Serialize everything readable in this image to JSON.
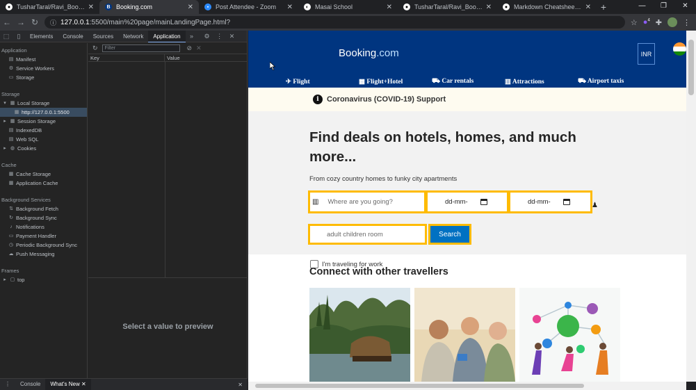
{
  "browser": {
    "tabs": [
      {
        "title": "TusharTaral/Ravi_Booking.com",
        "icon": "github-icon"
      },
      {
        "title": "Booking.com",
        "icon": "booking-icon",
        "active": true
      },
      {
        "title": "Post Attendee - Zoom",
        "icon": "zoom-icon"
      },
      {
        "title": "Masai School",
        "icon": "masai-icon"
      },
      {
        "title": "TusharTaral/Ravi_Booking.com",
        "icon": "github-icon"
      },
      {
        "title": "Markdown Cheatsheet - adam-p",
        "icon": "github-icon"
      }
    ],
    "new_tab": "+",
    "url_host": "127.0.0.1",
    "url_rest": ":5500/main%20page/mainLandingPage.html?",
    "extension_badge": "4",
    "window_controls": [
      "—",
      "❐",
      "✕"
    ]
  },
  "devtools": {
    "tabs": [
      "Elements",
      "Console",
      "Sources",
      "Network",
      "Application"
    ],
    "active_tab": "Application",
    "more": "»",
    "sidebar": {
      "application_header": "Application",
      "application_items": [
        "Manifest",
        "Service Workers",
        "Storage"
      ],
      "storage_header": "Storage",
      "local_storage": "Local Storage",
      "local_storage_origin": "http://127.0.0.1:5500",
      "storage_items": [
        "Session Storage",
        "IndexedDB",
        "Web SQL",
        "Cookies"
      ],
      "cache_header": "Cache",
      "cache_items": [
        "Cache Storage",
        "Application Cache"
      ],
      "bg_header": "Background Services",
      "bg_items": [
        "Background Fetch",
        "Background Sync",
        "Notifications",
        "Payment Handler",
        "Periodic Background Sync",
        "Push Messaging"
      ],
      "frames_header": "Frames",
      "frames_items": [
        "top"
      ]
    },
    "filter_placeholder": "Filter",
    "columns": [
      "Key",
      "Value"
    ],
    "preview_text": "Select a value to preview",
    "drawer_tabs": [
      "Console",
      "What's New"
    ]
  },
  "booking": {
    "logo_main": "Booking",
    "logo_dot": ".com",
    "currency": "INR",
    "nav": [
      "Flight",
      "Flight+Hotel",
      "Car rentals",
      "Attractions",
      "Airport taxis"
    ],
    "covid": "Coronavirus (COVID-19) Support",
    "heading": "Find deals on hotels, homes, and much more...",
    "subheading": "From cozy country homes to funky city apartments",
    "destination_placeholder": "Where are you going?",
    "checkin_placeholder": "dd-mm-",
    "checkout_placeholder": "dd-mm-",
    "guests_placeholder": "adult children room",
    "search_label": "Search",
    "work_travel_label": "I'm traveling for work",
    "connect_heading": "Connect with other travellers"
  }
}
